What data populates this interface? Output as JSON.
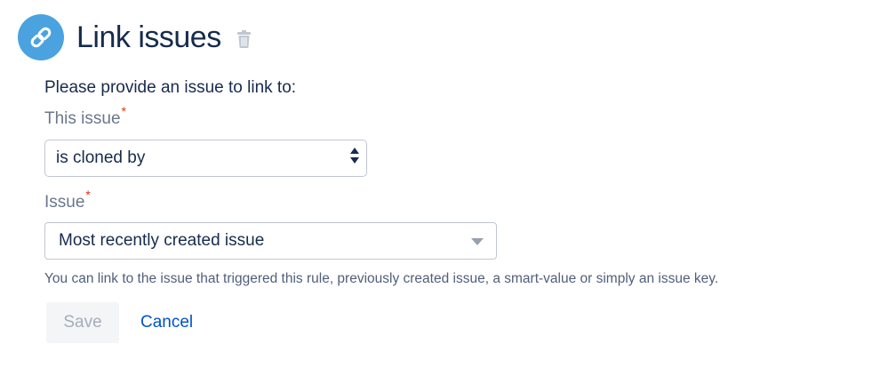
{
  "header": {
    "title": "Link issues",
    "icon": "link-icon",
    "delete_icon": "trash-icon",
    "badge_color": "#4aa3df"
  },
  "form": {
    "prompt": "Please provide an issue to link to:",
    "this_issue": {
      "label": "This issue",
      "required_marker": "*",
      "value": "is cloned by"
    },
    "issue": {
      "label": "Issue",
      "required_marker": "*",
      "value": "Most recently created issue"
    },
    "helper_text": "You can link to the issue that triggered this rule, previously created issue, a smart-value or simply an issue key."
  },
  "actions": {
    "save_label": "Save",
    "cancel_label": "Cancel"
  },
  "colors": {
    "accent": "#0052cc",
    "required": "#de350b",
    "title": "#172b4d"
  }
}
